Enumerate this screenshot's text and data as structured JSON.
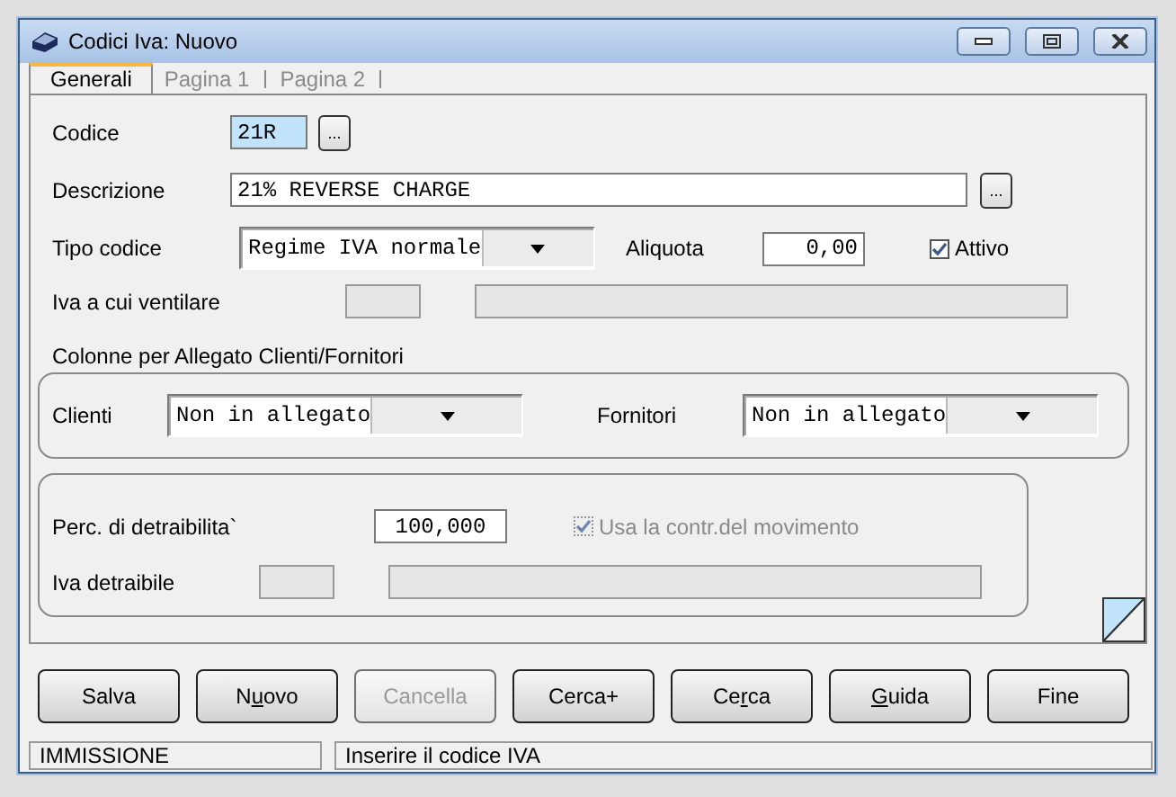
{
  "window": {
    "title": "Codici Iva: Nuovo"
  },
  "tabs": [
    {
      "label": "Generali",
      "selected": true
    },
    {
      "label": "Pagina 1",
      "selected": false
    },
    {
      "label": "Pagina 2",
      "selected": false
    }
  ],
  "codice": {
    "label": "Codice",
    "value": "21R",
    "lookup": "..."
  },
  "descrizione": {
    "label": "Descrizione",
    "value": "21% REVERSE CHARGE",
    "lookup": "..."
  },
  "tipo_codice": {
    "label": "Tipo codice",
    "value": "Regime IVA normale"
  },
  "aliquota": {
    "label": "Aliquota",
    "value": "0,00"
  },
  "attivo": {
    "label": "Attivo",
    "checked": true,
    "disabled": false
  },
  "iva_ventilare": {
    "label": "Iva a cui ventilare"
  },
  "allegato": {
    "title": "Colonne per Allegato Clienti/Fornitori",
    "clienti": {
      "label": "Clienti",
      "value": "Non in allegato"
    },
    "fornitori": {
      "label": "Fornitori",
      "value": "Non in allegato"
    }
  },
  "detraibilita": {
    "label": "Perc. di detraibilita`",
    "value": "100,000"
  },
  "usa_contr": {
    "label": "Usa la contr.del movimento",
    "checked": true,
    "disabled": true
  },
  "iva_detraibile": {
    "label": "Iva detraibile"
  },
  "buttons": [
    {
      "before": "Salva",
      "disabled": false
    },
    {
      "before": "N",
      "key": "u",
      "after": "ovo",
      "disabled": false
    },
    {
      "before": "Cancella",
      "disabled": true
    },
    {
      "before": "Cerca+",
      "disabled": false
    },
    {
      "before": "Ce",
      "key": "r",
      "after": "ca",
      "disabled": false
    },
    {
      "key": "G",
      "after": "uida",
      "disabled": false
    },
    {
      "before": "Fine",
      "disabled": false
    }
  ],
  "status_bar": {
    "mode": "IMMISSIONE",
    "message": "Inserire il codice IVA"
  }
}
